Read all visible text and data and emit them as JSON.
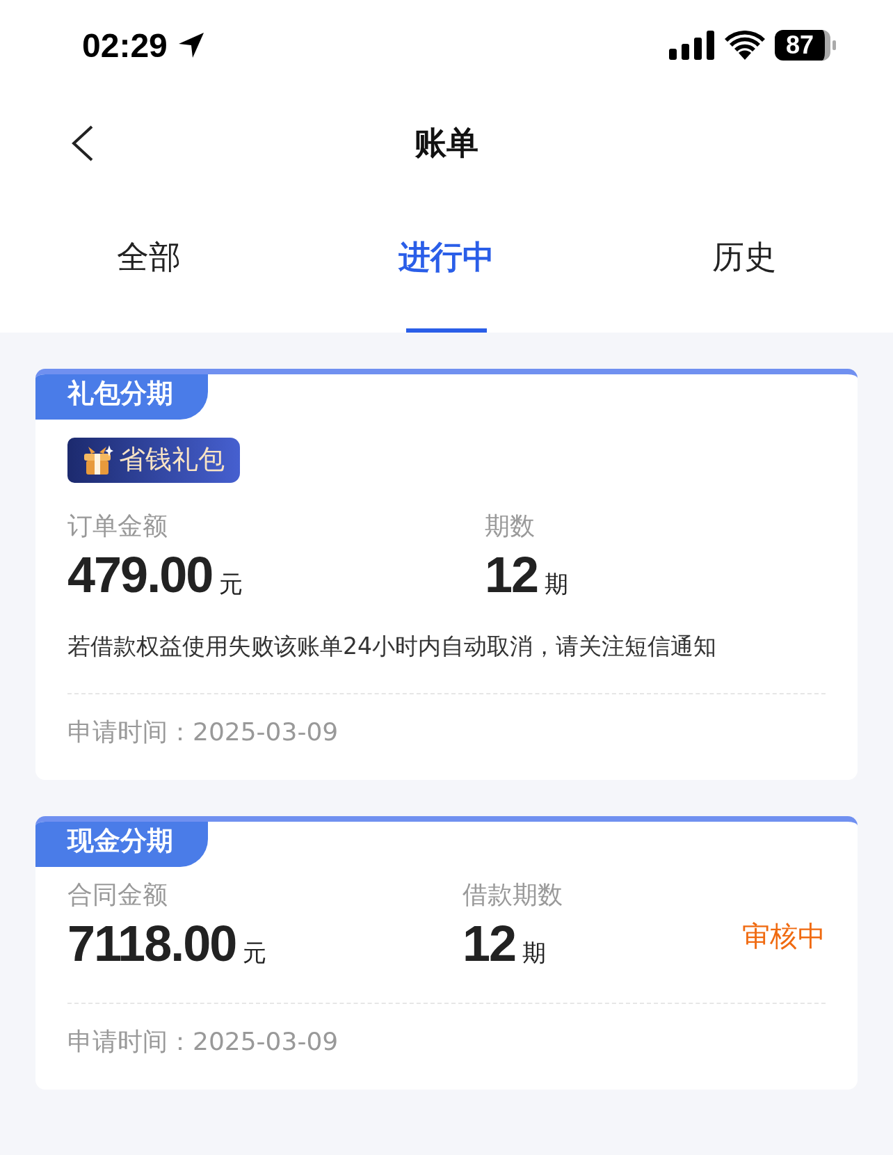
{
  "status_bar": {
    "time": "02:29",
    "battery": "87"
  },
  "nav": {
    "title": "账单"
  },
  "tabs": [
    {
      "label": "全部",
      "selected": false
    },
    {
      "label": "进行中",
      "selected": true
    },
    {
      "label": "历史",
      "selected": false
    }
  ],
  "cards": [
    {
      "tag": "礼包分期",
      "badge": "省钱礼包",
      "amount_label": "订单金额",
      "amount": "479.00",
      "amount_unit": "元",
      "term_label": "期数",
      "term": "12",
      "term_unit": "期",
      "notice": "若借款权益使用失败该账单24小时内自动取消，请关注短信通知",
      "date": "申请时间：2025-03-09"
    },
    {
      "tag": "现金分期",
      "amount_label": "合同金额",
      "amount": "7118.00",
      "amount_unit": "元",
      "term_label": "借款期数",
      "term": "12",
      "term_unit": "期",
      "status": "审核中",
      "date": "申请时间：2025-03-09"
    }
  ]
}
